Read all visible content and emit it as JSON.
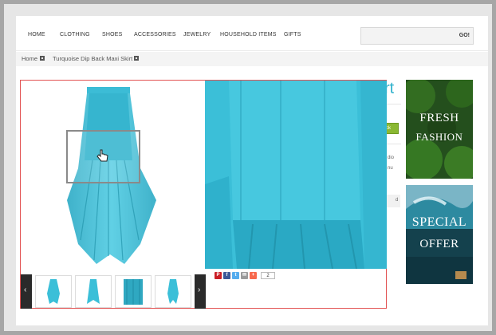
{
  "nav": {
    "items": [
      "HOME",
      "CLOTHING",
      "SHOES",
      "ACCESSORIES",
      "JEWELRY",
      "HOUSEHOLD ITEMS",
      "GIFTS"
    ],
    "search_placeholder": "",
    "go_label": "GO!"
  },
  "breadcrumb": [
    "Home",
    "Turquoise Dip Back Maxi Skirt"
  ],
  "product_fragments": {
    "title_tail": "rt",
    "button_tail": "ck",
    "desc_tails": [
      "dio",
      "nu",
      "d"
    ]
  },
  "share": {
    "count": "2",
    "icons": [
      "pinterest-icon",
      "facebook-icon",
      "twitter-icon",
      "email-icon",
      "addthis-icon"
    ]
  },
  "thumbnails": {
    "prev_label": "‹",
    "next_label": "›",
    "count": 4
  },
  "banners": [
    {
      "line1": "FRESH",
      "line2": "FASHION"
    },
    {
      "line1": "SPECIAL",
      "line2": "OFFER"
    }
  ],
  "colors": {
    "accent": "#2fb1cc",
    "skirt": "#3bbfd8",
    "viewer_border": "#e25252",
    "button": "#8ab832"
  }
}
